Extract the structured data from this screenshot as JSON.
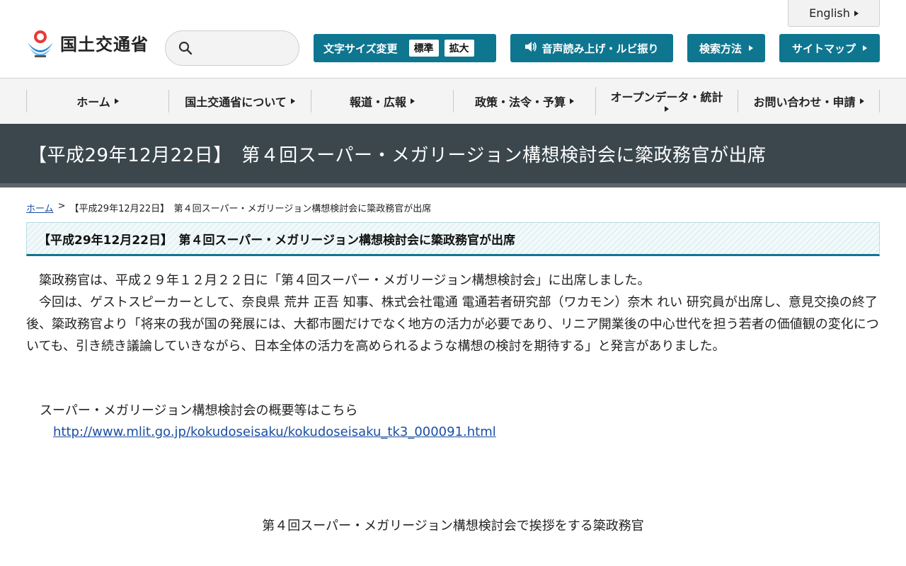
{
  "header": {
    "logo_text": "国土交通省",
    "english_label": "English",
    "search": {
      "placeholder": ""
    },
    "font_size": {
      "label": "文字サイズ変更",
      "standard": "標準",
      "large": "拡大"
    },
    "speech_label": "音声読み上げ・ルビ振り",
    "search_method_label": "検索方法",
    "sitemap_label": "サイトマップ",
    "colors": {
      "accent": "#0f7690",
      "title_band": "#3b474d"
    }
  },
  "nav": {
    "items": [
      {
        "label": "ホーム"
      },
      {
        "label": "国土交通省について"
      },
      {
        "label": "報道・広報"
      },
      {
        "label": "政策・法令・予算"
      },
      {
        "label": "オープンデータ・統計"
      },
      {
        "label": "お問い合わせ・申請"
      }
    ]
  },
  "page": {
    "title": "【平成29年12月22日】　第４回スーパー・メガリージョン構想検討会に簗政務官が出席",
    "breadcrumb": {
      "home": "ホーム",
      "separator": ">",
      "current": "【平成29年12月22日】　第４回スーパー・メガリージョン構想検討会に簗政務官が出席"
    },
    "heading": "【平成29年12月22日】　第４回スーパー・メガリージョン構想検討会に簗政務官が出席",
    "paragraphs": [
      "簗政務官は、平成２９年１２月２２日に「第４回スーパー・メガリージョン構想検討会」に出席しました。",
      "今回は、ゲストスピーカーとして、奈良県 荒井 正吾 知事、株式会社電通 電通若者研究部（ワカモン）奈木 れい 研究員が出席し、意見交換の終了後、簗政務官より「将来の我が国の発展には、大都市圏だけでなく地方の活力が必要であり、リニア開業後の中心世代を担う若者の価値観の変化についても、引き続き議論していきながら、日本全体の活力を高められるような構想の検討を期待する」と発言がありました。"
    ],
    "link_intro": "スーパー・メガリージョン構想検討会の概要等はこちら",
    "link_url": "http://www.mlit.go.jp/kokudoseisaku/kokudoseisaku_tk3_000091.html",
    "photo_caption": "第４回スーパー・メガリージョン構想検討会で挨拶をする簗政務官"
  }
}
